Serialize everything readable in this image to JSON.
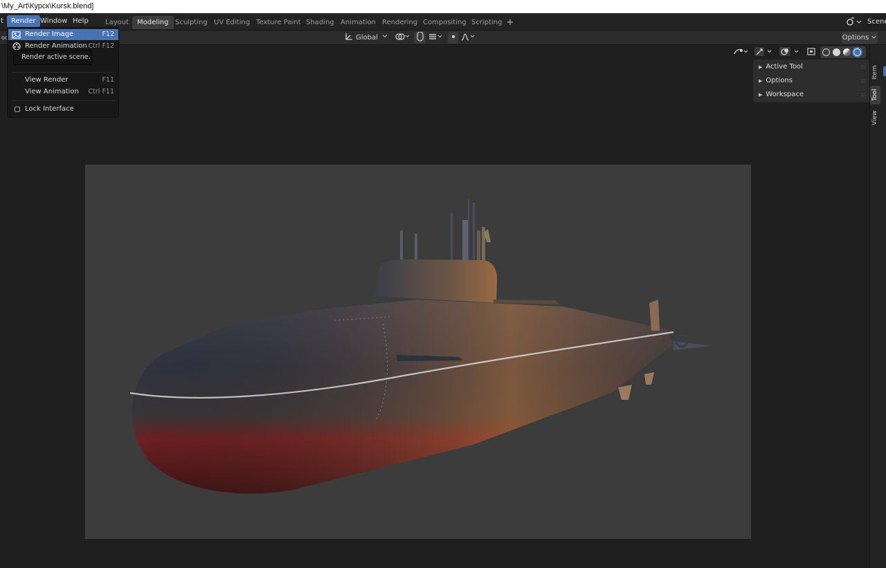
{
  "window": {
    "title": "\\My_Art\\Курск\\Kursk.blend]"
  },
  "menubar": {
    "cut_fragment": "t",
    "items": [
      "Render",
      "Window",
      "Help"
    ],
    "active_index": 0
  },
  "workspace_tabs": {
    "items": [
      "Layout",
      "Modeling",
      "Sculpting",
      "UV Editing",
      "Texture Paint",
      "Shading",
      "Animation",
      "Rendering",
      "Compositing",
      "Scripting"
    ],
    "active": "Modeling",
    "add_label": "+"
  },
  "scene_selector": {
    "label": "Scene"
  },
  "header": {
    "transform_orientation": "Global",
    "options_label": "Options",
    "left_fragment": "od"
  },
  "render_menu": {
    "items": [
      {
        "label": "Render Image",
        "shortcut": "F12",
        "highlighted": true,
        "icon": "render-image-icon"
      },
      {
        "label": "Render Animation",
        "shortcut": "Ctrl F12",
        "highlighted": false,
        "icon": "render-animation-icon"
      },
      {
        "label": "View Render",
        "shortcut": "F11",
        "highlighted": false
      },
      {
        "label": "View Animation",
        "shortcut": "Ctrl F11",
        "highlighted": false
      },
      {
        "label": "Lock Interface",
        "shortcut": "",
        "checkbox": true,
        "checked": false
      }
    ],
    "tooltip": "Render active scene."
  },
  "sidebar_panel": {
    "rows": [
      "Active Tool",
      "Options",
      "Workspace"
    ]
  },
  "side_tabs": {
    "items": [
      "Item",
      "Tool",
      "View"
    ],
    "active": "Tool"
  },
  "colors": {
    "accent": "#4772b3",
    "background": "#1d1d1d",
    "camera_bg": "#3c3c3c"
  }
}
